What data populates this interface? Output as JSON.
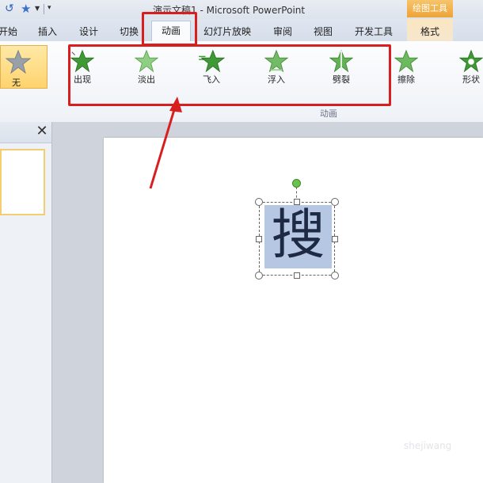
{
  "window": {
    "title": "演示文稿1 - Microsoft PowerPoint",
    "context_header": "绘图工具"
  },
  "tabs": [
    {
      "label": "开始"
    },
    {
      "label": "插入"
    },
    {
      "label": "设计"
    },
    {
      "label": "切换"
    },
    {
      "label": "动画",
      "active": true
    },
    {
      "label": "幻灯片放映"
    },
    {
      "label": "审阅"
    },
    {
      "label": "视图"
    },
    {
      "label": "开发工具"
    },
    {
      "label": "格式"
    }
  ],
  "ribbon": {
    "none_label": "无",
    "animations": [
      {
        "label": "出现",
        "icon": "star-appear-icon"
      },
      {
        "label": "淡出",
        "icon": "star-fade-icon"
      },
      {
        "label": "飞入",
        "icon": "star-fly-in-icon"
      },
      {
        "label": "浮入",
        "icon": "star-float-in-icon"
      },
      {
        "label": "劈裂",
        "icon": "star-split-icon"
      },
      {
        "label": "擦除",
        "icon": "star-wipe-icon"
      },
      {
        "label": "形状",
        "icon": "star-shape-icon"
      }
    ],
    "group_label": "动画"
  },
  "slide": {
    "text": "搜"
  },
  "colors": {
    "annotation_red": "#d81e1e",
    "star_green": "#3f9a35",
    "context_orange": "#eea336",
    "selection_blue": "#b6c7e3"
  },
  "watermark": "shejiwang"
}
